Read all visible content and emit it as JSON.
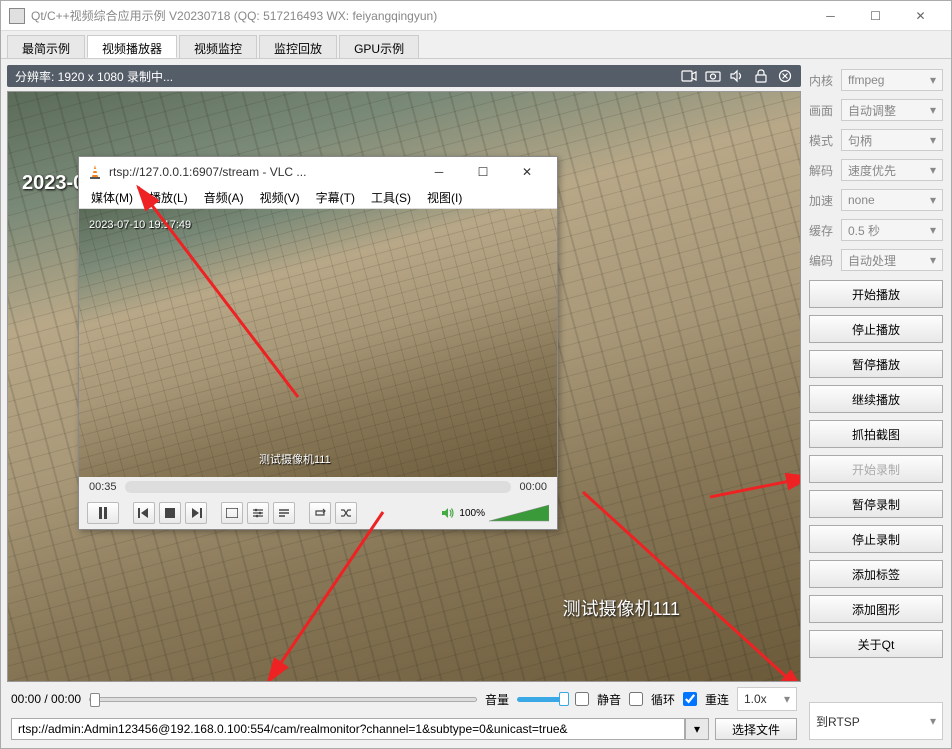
{
  "window": {
    "title": "Qt/C++视频综合应用示例 V20230718 (QQ: 517216493 WX: feiyangqingyun)"
  },
  "tabs": [
    "最简示例",
    "视频播放器",
    "视频监控",
    "监控回放",
    "GPU示例"
  ],
  "active_tab": 1,
  "status": {
    "text": "分辨率: 1920 x 1080 录制中..."
  },
  "osd": {
    "date": "2023-0",
    "watermark": "测试摄像机111",
    "center_text": "测试摄像机111"
  },
  "vlc": {
    "title": "rtsp://127.0.0.1:6907/stream - VLC ...",
    "menus": [
      "媒体(M)",
      "播放(L)",
      "音频(A)",
      "视频(V)",
      "字幕(T)",
      "工具(S)",
      "视图(I)"
    ],
    "osd_time": "2023-07-10 19:17:49",
    "osd_watermark": "测试摄像机111",
    "cur_time": "00:35",
    "end_time": "00:00",
    "volume": "100%"
  },
  "bottom": {
    "time": "00:00 / 00:00",
    "vol_label": "音量",
    "mute_label": "静音",
    "loop_label": "循环",
    "reconnect_label": "重连",
    "reconnect_checked": true,
    "speed": "1.0x",
    "url": "rtsp://admin:Admin123456@192.168.0.100:554/cam/realmonitor?channel=1&subtype=0&unicast=true&",
    "select_file": "选择文件",
    "target": "到RTSP"
  },
  "side": {
    "labels": {
      "core": "内核",
      "screen": "画面",
      "mode": "模式",
      "decode": "解码",
      "accel": "加速",
      "cache": "缓存",
      "codec": "编码"
    },
    "values": {
      "core": "ffmpeg",
      "screen": "自动调整",
      "mode": "句柄",
      "decode": "速度优先",
      "accel": "none",
      "cache": "0.5 秒",
      "codec": "自动处理"
    },
    "buttons": [
      "开始播放",
      "停止播放",
      "暂停播放",
      "继续播放",
      "抓拍截图",
      "开始录制",
      "暂停录制",
      "停止录制",
      "添加标签",
      "添加图形",
      "关于Qt"
    ]
  }
}
